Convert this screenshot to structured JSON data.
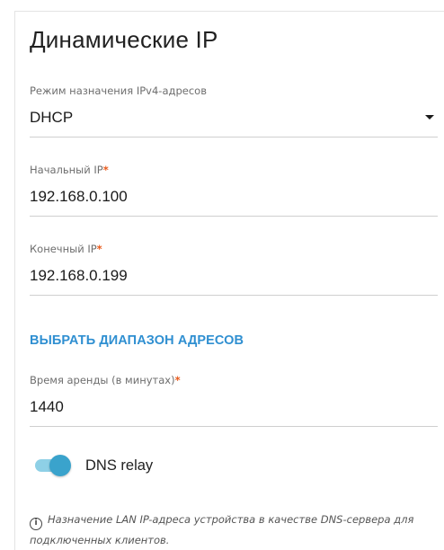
{
  "section": {
    "title": "Динамические IP"
  },
  "mode_field": {
    "label": "Режим назначения IPv4-адресов",
    "value": "DHCP"
  },
  "start_ip_field": {
    "label": "Начальный IP",
    "required_mark": "*",
    "value": "192.168.0.100"
  },
  "end_ip_field": {
    "label": "Конечный IP",
    "required_mark": "*",
    "value": "192.168.0.199"
  },
  "range_link": {
    "label": "ВЫБРАТЬ ДИАПАЗОН АДРЕСОВ"
  },
  "lease_field": {
    "label": "Время аренды (в минутах)",
    "required_mark": "*",
    "value": "1440"
  },
  "dns_relay": {
    "label": "DNS relay",
    "enabled": true
  },
  "note": {
    "icon": "info-icon",
    "text": "Назначение LAN IP-адреса устройства в качестве DNS-сервера для подключенных клиентов."
  },
  "colors": {
    "accent": "#2f8fd1",
    "required": "#e8591a",
    "toggle_knob": "#3aa3cc",
    "toggle_track": "#8ed0e6"
  }
}
